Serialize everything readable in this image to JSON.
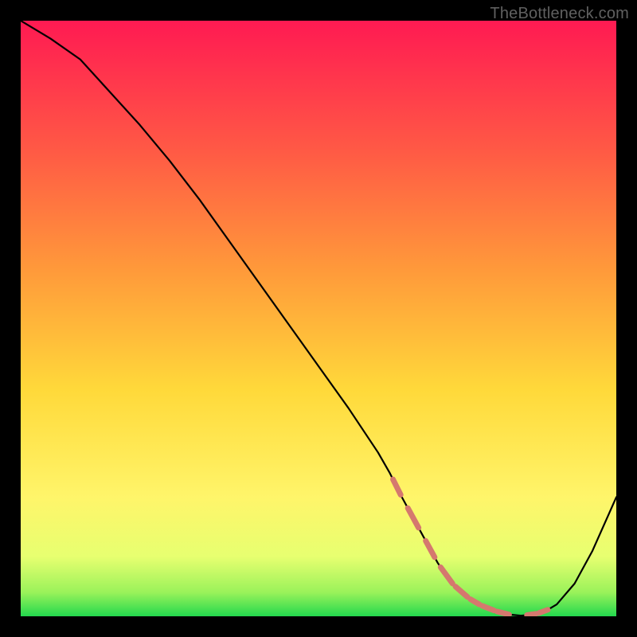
{
  "watermark": "TheBottleneck.com",
  "chart_data": {
    "type": "line",
    "title": "",
    "subtitle": "",
    "xlabel": "",
    "ylabel": "",
    "xlim": [
      0,
      100
    ],
    "ylim": [
      0,
      100
    ],
    "grid": false,
    "legend": false,
    "axes_visible": false,
    "curve": {
      "name": "bottleneck-curve",
      "x": [
        0,
        5,
        10,
        15,
        20,
        25,
        30,
        35,
        40,
        45,
        50,
        55,
        60,
        62,
        64,
        67,
        70,
        72,
        74,
        76,
        78,
        80,
        82,
        84,
        86,
        88,
        90,
        93,
        96,
        100
      ],
      "y": [
        100,
        97,
        93.5,
        88,
        82.5,
        76.5,
        70,
        63,
        56,
        49,
        42,
        35,
        27.5,
        24,
        20,
        14.5,
        9,
        6,
        4,
        2.5,
        1.5,
        0.8,
        0.3,
        0.1,
        0.3,
        0.8,
        2,
        5.5,
        11,
        20
      ]
    },
    "optimal_zone": {
      "description": "approximate flat-bottom region marked with salmon dashes",
      "x_start": 62,
      "x_end": 88
    },
    "dash_markers": {
      "color": "#d5786e",
      "segments_x": [
        [
          62.5,
          63.8
        ],
        [
          65.0,
          66.8
        ],
        [
          68.0,
          69.5
        ],
        [
          70.5,
          72.5
        ],
        [
          73.0,
          75.0
        ],
        [
          75.5,
          77.0
        ],
        [
          77.5,
          79.5
        ],
        [
          80.0,
          82.0
        ],
        [
          85.0,
          86.5
        ],
        [
          87.0,
          88.5
        ]
      ]
    },
    "background_gradient": {
      "top_color": "#ff1a52",
      "mid1_color": "#ff8a3a",
      "mid2_color": "#ffe63a",
      "mid3_color": "#faff7a",
      "bottom_color": "#23d84e"
    }
  }
}
